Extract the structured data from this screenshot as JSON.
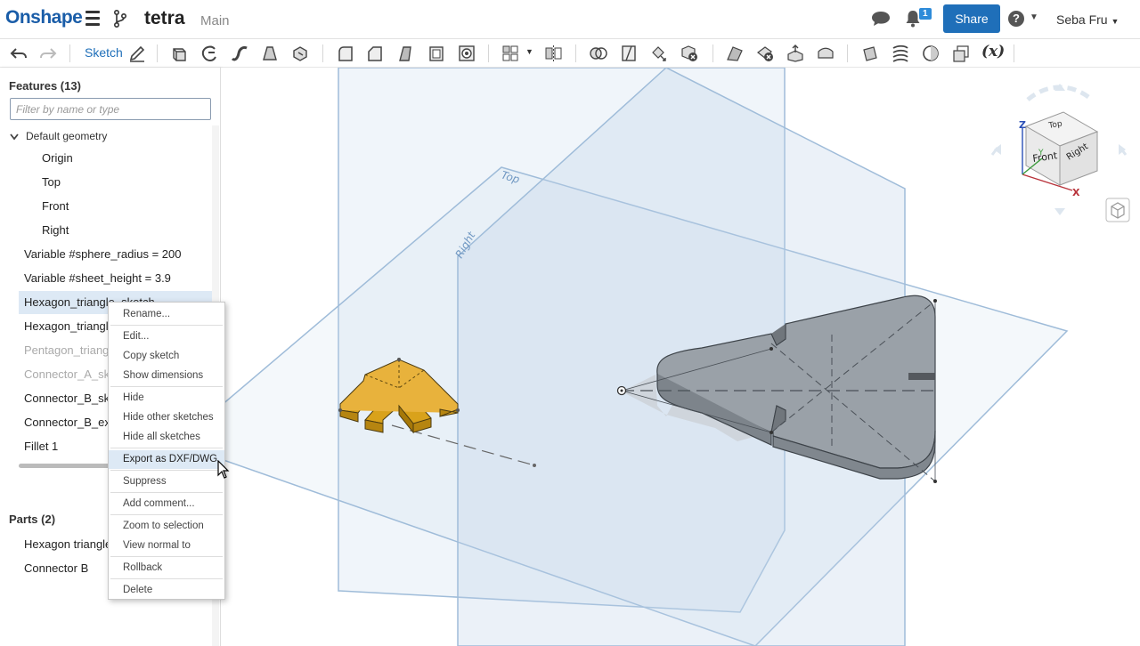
{
  "app": {
    "brand": "Onshape",
    "document_title": "tetra",
    "workspace": "Main"
  },
  "header": {
    "notification_count": "1",
    "share_label": "Share",
    "help_label": "?",
    "user_name": "Seba Fru"
  },
  "toolbar": {
    "sketch_label": "Sketch",
    "variable_label": "(x)"
  },
  "sidebar": {
    "features_title": "Features (13)",
    "filter_placeholder": "Filter by name or type",
    "default_geometry": "Default geometry",
    "geometry": [
      "Origin",
      "Top",
      "Front",
      "Right"
    ],
    "features": [
      "Variable #sphere_radius = 200",
      "Variable #sheet_height = 3.9",
      "Hexagon_triangle_sketch",
      "Hexagon_triangle",
      "Pentagon_triangle",
      "Connector_A_sketch",
      "Connector_B_sketch",
      "Connector_B_extrude",
      "Fillet 1"
    ],
    "parts_title": "Parts (2)",
    "parts": [
      "Hexagon triangle",
      "Connector B"
    ]
  },
  "context_menu": {
    "items": [
      "Rename...",
      "Edit...",
      "Copy sketch",
      "Show dimensions",
      "Hide",
      "Hide other sketches",
      "Hide all sketches",
      "Export as DXF/DWG",
      "Suppress",
      "Add comment...",
      "Zoom to selection",
      "View normal to",
      "Rollback",
      "Delete"
    ]
  },
  "viewport": {
    "plane_top": "Top",
    "plane_right": "Right",
    "cube_top": "Top",
    "cube_front": "Front",
    "cube_right": "Right",
    "axis_x": "X",
    "axis_y": "Y",
    "axis_z": "Z"
  },
  "colors": {
    "accent": "#1f6fb9",
    "part_gray": "#8a929b",
    "part_gold": "#d9a21b",
    "plane": "#a9c4e0"
  }
}
